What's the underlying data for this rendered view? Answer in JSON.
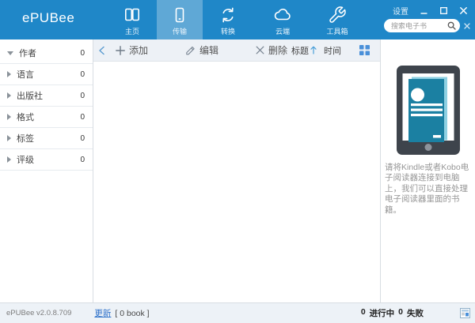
{
  "header": {
    "logo": "ePUBee",
    "nav": [
      {
        "label": "主页",
        "icon": "book-icon",
        "active": false
      },
      {
        "label": "传输",
        "icon": "smartphone-icon",
        "active": true
      },
      {
        "label": "转换",
        "icon": "sync-icon",
        "active": false
      },
      {
        "label": "云端",
        "icon": "cloud-icon",
        "active": false
      },
      {
        "label": "工具箱",
        "icon": "wrench-icon",
        "active": false
      }
    ],
    "settings_label": "设置",
    "search": {
      "placeholder": "搜索电子书"
    }
  },
  "sidebar": {
    "items": [
      {
        "label": "作者",
        "count": "0",
        "expanded": true
      },
      {
        "label": "语言",
        "count": "0",
        "expanded": false
      },
      {
        "label": "出版社",
        "count": "0",
        "expanded": false
      },
      {
        "label": "格式",
        "count": "0",
        "expanded": false
      },
      {
        "label": "标签",
        "count": "0",
        "expanded": false
      },
      {
        "label": "评级",
        "count": "0",
        "expanded": false
      }
    ]
  },
  "toolbar": {
    "add_label": "添加",
    "edit_label": "编辑",
    "delete_label": "删除",
    "sort_title_label": "标题",
    "sort_time_label": "时间"
  },
  "right_panel": {
    "hint": "请将Kindle或者Kobo电子阅读器连接到电脑上，我们可以直接处理电子阅读器里面的书籍。"
  },
  "footer": {
    "version": "ePUBee v2.0.8.709",
    "update_label": "更新",
    "book_count": "[ 0 book ]",
    "in_progress_count": "0",
    "in_progress_label": "进行中",
    "failed_count": "0",
    "failed_label": "失败"
  },
  "colors": {
    "header_blue": "#1f87c8",
    "active_tab_blue": "#5fa8d6",
    "accent_blue": "#4a9fd8",
    "link_blue": "#2a6fc9",
    "book_teal": "#1b80a2",
    "tablet_frame": "#3e444c"
  }
}
